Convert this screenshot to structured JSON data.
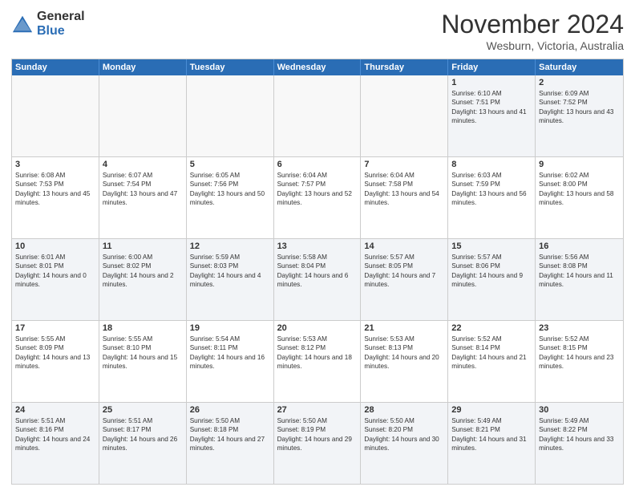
{
  "logo": {
    "general": "General",
    "blue": "Blue"
  },
  "title": "November 2024",
  "location": "Wesburn, Victoria, Australia",
  "header": {
    "days": [
      "Sunday",
      "Monday",
      "Tuesday",
      "Wednesday",
      "Thursday",
      "Friday",
      "Saturday"
    ]
  },
  "weeks": [
    [
      {
        "day": "",
        "empty": true
      },
      {
        "day": "",
        "empty": true
      },
      {
        "day": "",
        "empty": true
      },
      {
        "day": "",
        "empty": true
      },
      {
        "day": "",
        "empty": true
      },
      {
        "day": "1",
        "sunrise": "6:10 AM",
        "sunset": "7:51 PM",
        "daylight": "13 hours and 41 minutes."
      },
      {
        "day": "2",
        "sunrise": "6:09 AM",
        "sunset": "7:52 PM",
        "daylight": "13 hours and 43 minutes."
      }
    ],
    [
      {
        "day": "3",
        "sunrise": "6:08 AM",
        "sunset": "7:53 PM",
        "daylight": "13 hours and 45 minutes."
      },
      {
        "day": "4",
        "sunrise": "6:07 AM",
        "sunset": "7:54 PM",
        "daylight": "13 hours and 47 minutes."
      },
      {
        "day": "5",
        "sunrise": "6:05 AM",
        "sunset": "7:56 PM",
        "daylight": "13 hours and 50 minutes."
      },
      {
        "day": "6",
        "sunrise": "6:04 AM",
        "sunset": "7:57 PM",
        "daylight": "13 hours and 52 minutes."
      },
      {
        "day": "7",
        "sunrise": "6:04 AM",
        "sunset": "7:58 PM",
        "daylight": "13 hours and 54 minutes."
      },
      {
        "day": "8",
        "sunrise": "6:03 AM",
        "sunset": "7:59 PM",
        "daylight": "13 hours and 56 minutes."
      },
      {
        "day": "9",
        "sunrise": "6:02 AM",
        "sunset": "8:00 PM",
        "daylight": "13 hours and 58 minutes."
      }
    ],
    [
      {
        "day": "10",
        "sunrise": "6:01 AM",
        "sunset": "8:01 PM",
        "daylight": "14 hours and 0 minutes."
      },
      {
        "day": "11",
        "sunrise": "6:00 AM",
        "sunset": "8:02 PM",
        "daylight": "14 hours and 2 minutes."
      },
      {
        "day": "12",
        "sunrise": "5:59 AM",
        "sunset": "8:03 PM",
        "daylight": "14 hours and 4 minutes."
      },
      {
        "day": "13",
        "sunrise": "5:58 AM",
        "sunset": "8:04 PM",
        "daylight": "14 hours and 6 minutes."
      },
      {
        "day": "14",
        "sunrise": "5:57 AM",
        "sunset": "8:05 PM",
        "daylight": "14 hours and 7 minutes."
      },
      {
        "day": "15",
        "sunrise": "5:57 AM",
        "sunset": "8:06 PM",
        "daylight": "14 hours and 9 minutes."
      },
      {
        "day": "16",
        "sunrise": "5:56 AM",
        "sunset": "8:08 PM",
        "daylight": "14 hours and 11 minutes."
      }
    ],
    [
      {
        "day": "17",
        "sunrise": "5:55 AM",
        "sunset": "8:09 PM",
        "daylight": "14 hours and 13 minutes."
      },
      {
        "day": "18",
        "sunrise": "5:55 AM",
        "sunset": "8:10 PM",
        "daylight": "14 hours and 15 minutes."
      },
      {
        "day": "19",
        "sunrise": "5:54 AM",
        "sunset": "8:11 PM",
        "daylight": "14 hours and 16 minutes."
      },
      {
        "day": "20",
        "sunrise": "5:53 AM",
        "sunset": "8:12 PM",
        "daylight": "14 hours and 18 minutes."
      },
      {
        "day": "21",
        "sunrise": "5:53 AM",
        "sunset": "8:13 PM",
        "daylight": "14 hours and 20 minutes."
      },
      {
        "day": "22",
        "sunrise": "5:52 AM",
        "sunset": "8:14 PM",
        "daylight": "14 hours and 21 minutes."
      },
      {
        "day": "23",
        "sunrise": "5:52 AM",
        "sunset": "8:15 PM",
        "daylight": "14 hours and 23 minutes."
      }
    ],
    [
      {
        "day": "24",
        "sunrise": "5:51 AM",
        "sunset": "8:16 PM",
        "daylight": "14 hours and 24 minutes."
      },
      {
        "day": "25",
        "sunrise": "5:51 AM",
        "sunset": "8:17 PM",
        "daylight": "14 hours and 26 minutes."
      },
      {
        "day": "26",
        "sunrise": "5:50 AM",
        "sunset": "8:18 PM",
        "daylight": "14 hours and 27 minutes."
      },
      {
        "day": "27",
        "sunrise": "5:50 AM",
        "sunset": "8:19 PM",
        "daylight": "14 hours and 29 minutes."
      },
      {
        "day": "28",
        "sunrise": "5:50 AM",
        "sunset": "8:20 PM",
        "daylight": "14 hours and 30 minutes."
      },
      {
        "day": "29",
        "sunrise": "5:49 AM",
        "sunset": "8:21 PM",
        "daylight": "14 hours and 31 minutes."
      },
      {
        "day": "30",
        "sunrise": "5:49 AM",
        "sunset": "8:22 PM",
        "daylight": "14 hours and 33 minutes."
      }
    ]
  ]
}
